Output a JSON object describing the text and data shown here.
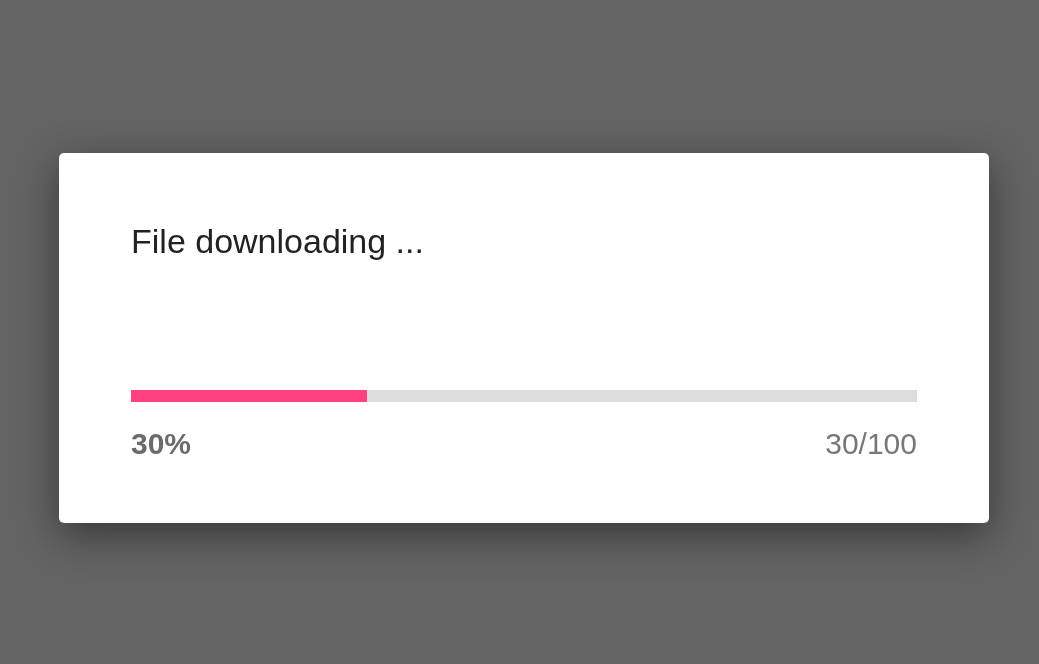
{
  "dialog": {
    "title": "File downloading ...",
    "progress": {
      "level": 0.3
    },
    "percent": "30%",
    "count": "30/100"
  }
}
